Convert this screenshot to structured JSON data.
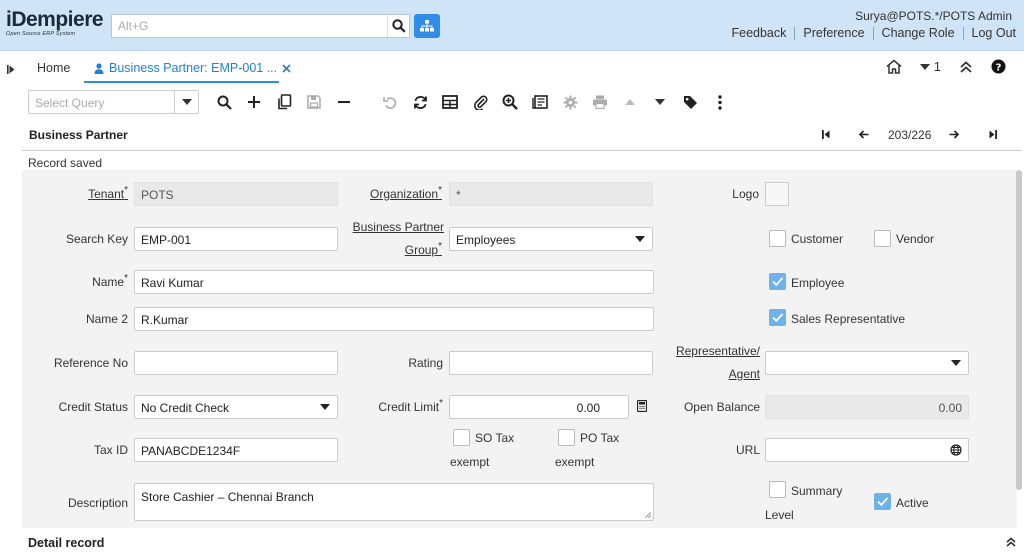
{
  "header": {
    "logo_text": "iDempiere",
    "logo_subtitle": "Open Source ERP System",
    "search_placeholder": "Alt+G",
    "user": "Surya@POTS.*/POTS Admin",
    "links": [
      "Feedback",
      "Preference",
      "Change Role",
      "Log Out"
    ]
  },
  "tabs": {
    "home": "Home",
    "active": "Business Partner: EMP-001 ...",
    "count": "1"
  },
  "toolbar": {
    "query_placeholder": "Select Query"
  },
  "window": {
    "title": "Business Partner",
    "record_position": "203/226",
    "status": "Record saved"
  },
  "form": {
    "tenant": {
      "label": "Tenant",
      "value": "POTS"
    },
    "organization": {
      "label": "Organization",
      "value": "*"
    },
    "logo": {
      "label": "Logo"
    },
    "search_key": {
      "label": "Search Key",
      "value": "EMP-001"
    },
    "bp_group": {
      "label_line1": "Business Partner",
      "label_line2": "Group",
      "value": "Employees"
    },
    "customer": {
      "label": "Customer",
      "checked": false
    },
    "vendor": {
      "label": "Vendor",
      "checked": false
    },
    "name": {
      "label": "Name",
      "value": "Ravi Kumar"
    },
    "employee": {
      "label": "Employee",
      "checked": true
    },
    "name2": {
      "label": "Name 2",
      "value": "R.Kumar"
    },
    "sales_rep": {
      "label": "Sales Representative",
      "checked": true
    },
    "reference_no": {
      "label": "Reference No",
      "value": ""
    },
    "rating": {
      "label": "Rating",
      "value": ""
    },
    "rep_agent": {
      "label_line1": "Representative/",
      "label_line2": "Agent",
      "value": ""
    },
    "credit_status": {
      "label": "Credit Status",
      "value": "No Credit Check"
    },
    "credit_limit": {
      "label": "Credit Limit",
      "value": "0.00"
    },
    "open_balance": {
      "label": "Open Balance",
      "value": "0.00"
    },
    "so_tax_exempt": {
      "label_line1": "SO Tax",
      "label_line2": "exempt",
      "checked": false
    },
    "po_tax_exempt": {
      "label_line1": "PO Tax",
      "label_line2": "exempt",
      "checked": false
    },
    "tax_id": {
      "label": "Tax ID",
      "value": "PANABCDE1234F"
    },
    "url": {
      "label": "URL",
      "value": ""
    },
    "description": {
      "label": "Description",
      "value": "Store Cashier – Chennai Branch"
    },
    "summary_level": {
      "label_line1": "Summary",
      "label_line2": "Level",
      "checked": false
    },
    "active": {
      "label": "Active",
      "checked": true
    }
  },
  "detail": {
    "title": "Detail record"
  }
}
